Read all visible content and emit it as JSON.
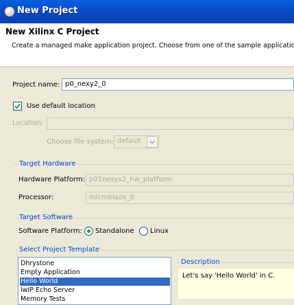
{
  "window": {
    "title": "New Project"
  },
  "banner": {
    "title": "New Xilinx C Project",
    "description": "Create a managed make application project. Choose from one of the sample applicatio"
  },
  "project_name": {
    "label": "Project name:",
    "value": "p0_nexy2_0"
  },
  "use_default_location": {
    "label": "Use default location",
    "checked": true
  },
  "location": {
    "label": "Location:",
    "value": ""
  },
  "file_system": {
    "label": "Choose file system:",
    "value": "default"
  },
  "target_hardware": {
    "title": "Target Hardware",
    "platform_label": "Hardware Platform:",
    "platform_value": "p01nesys2_hw_platform",
    "processor_label": "Processor:",
    "processor_value": "microblaze_0"
  },
  "target_software": {
    "title": "Target Software",
    "platform_label": "Software Platform:",
    "options": [
      {
        "label": "Standalone",
        "selected": true
      },
      {
        "label": "Linux",
        "selected": false
      }
    ]
  },
  "template": {
    "title": "Select Project Template",
    "items": [
      "Dhrystone",
      "Empty Application",
      "Hello World",
      "lwIP Echo Server",
      "Memory Tests"
    ],
    "selected": "Hello World",
    "description_title": "Description",
    "description_text": "Let's say 'Hello World' in C."
  },
  "colors": {
    "title_bar": "#0b49c4",
    "group_title": "#0046d5",
    "selection": "#316ac5",
    "tooltip_bg": "#ffffe1"
  }
}
